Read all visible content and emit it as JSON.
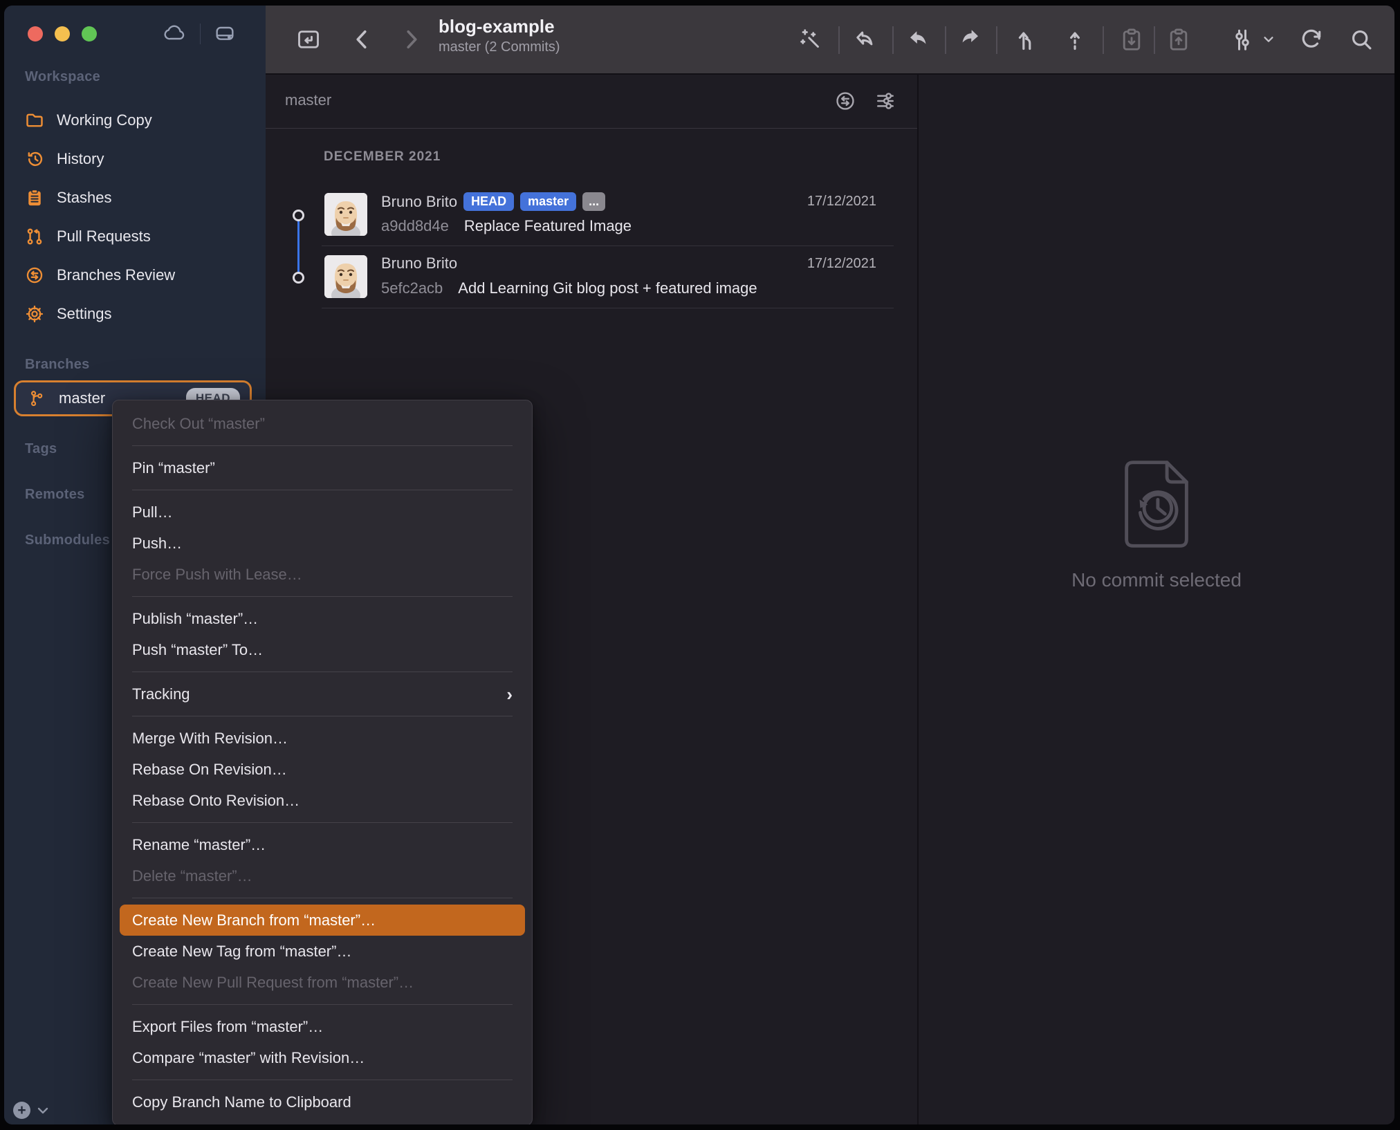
{
  "titlebar": {
    "repo_title": "blog-example",
    "repo_subtitle": "master (2 Commits)"
  },
  "sidebar": {
    "workspace_label": "Workspace",
    "workspace_items": [
      {
        "label": "Working Copy",
        "icon": "folder-icon"
      },
      {
        "label": "History",
        "icon": "history-clock-icon"
      },
      {
        "label": "Stashes",
        "icon": "clipboard-icon"
      },
      {
        "label": "Pull Requests",
        "icon": "pull-request-icon"
      },
      {
        "label": "Branches Review",
        "icon": "swap-circle-icon"
      },
      {
        "label": "Settings",
        "icon": "gear-icon"
      }
    ],
    "branches_label": "Branches",
    "current_branch": {
      "name": "master",
      "badge": "HEAD",
      "icon": "git-branch-icon"
    },
    "tags_label": "Tags",
    "remotes_label": "Remotes",
    "submodules_label": "Submodules"
  },
  "toolbar_icons": [
    "open-repo-icon",
    "back-chevron-icon",
    "forward-chevron-icon",
    "magic-wand-icon",
    "undo-arrow-icon",
    "pull-arrow-icon",
    "push-arrow-icon",
    "merge-icon",
    "rebase-dashed-arrow-icon",
    "stash-apply-clipboard-down-icon",
    "stash-save-clipboard-up-icon",
    "view-options-sliders-icon",
    "chevron-down-icon",
    "refresh-icon",
    "search-icon"
  ],
  "filter_bar": {
    "query": "master",
    "icons": [
      "compare-swap-circle-icon",
      "filter-sliders-icon"
    ]
  },
  "history": {
    "section_header": "DECEMBER 2021",
    "commits": [
      {
        "author": "Bruno Brito",
        "badges": [
          "HEAD",
          "master",
          "..."
        ],
        "date": "17/12/2021",
        "hash": "a9dd8d4e",
        "message": "Replace Featured Image"
      },
      {
        "author": "Bruno Brito",
        "badges": [],
        "date": "17/12/2021",
        "hash": "5efc2acb",
        "message": "Add Learning Git blog post + featured image"
      }
    ]
  },
  "detail_panel": {
    "empty_message": "No commit selected"
  },
  "context_menu": {
    "items": [
      {
        "label": "Check Out “master”",
        "state": "disabled"
      },
      {
        "label": "Pin “master”",
        "state": "normal"
      },
      {
        "label": "Pull…",
        "state": "normal"
      },
      {
        "label": "Push…",
        "state": "normal"
      },
      {
        "label": "Force Push with Lease…",
        "state": "disabled"
      },
      {
        "label": "Publish “master”…",
        "state": "normal"
      },
      {
        "label": "Push “master” To…",
        "state": "normal"
      },
      {
        "label": "Tracking",
        "state": "normal",
        "has_submenu": true
      },
      {
        "label": "Merge With Revision…",
        "state": "normal"
      },
      {
        "label": "Rebase On Revision…",
        "state": "normal"
      },
      {
        "label": "Rebase Onto Revision…",
        "state": "normal"
      },
      {
        "label": "Rename “master”…",
        "state": "normal"
      },
      {
        "label": "Delete “master”…",
        "state": "disabled"
      },
      {
        "label": "Create New Branch from “master”…",
        "state": "highlighted"
      },
      {
        "label": "Create New Tag from “master”…",
        "state": "normal"
      },
      {
        "label": "Create New Pull Request from “master”…",
        "state": "disabled"
      },
      {
        "label": "Export Files from “master”…",
        "state": "normal"
      },
      {
        "label": "Compare “master” with Revision…",
        "state": "normal"
      },
      {
        "label": "Copy Branch Name to Clipboard",
        "state": "normal"
      }
    ]
  },
  "glyphs": {
    "submenu_chevron": "›",
    "plus": "+"
  },
  "colors": {
    "sidebar_bg": "#222938",
    "toolbar_bg": "#3b383d",
    "panel_bg": "#1e1c23",
    "menu_bg": "#2c2a31",
    "accent_orange": "#ee8e35",
    "selection_border_orange": "#d8802f",
    "menu_highlight_orange": "#c2671e",
    "badge_blue": "#4472da",
    "graph_blue": "#3a74e8"
  }
}
